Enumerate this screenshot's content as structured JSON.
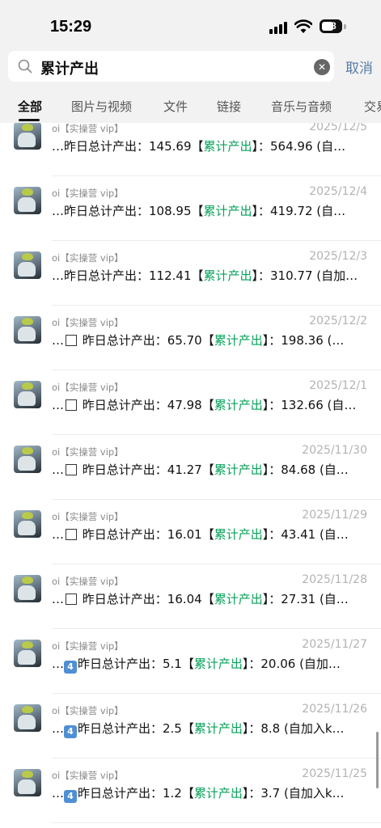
{
  "status": {
    "time": "15:29",
    "battery": "38"
  },
  "search": {
    "query": "累计产出",
    "cancel_label": "取消"
  },
  "tabs": [
    "全部",
    "图片与视频",
    "文件",
    "链接",
    "音乐与音频",
    "交易"
  ],
  "results": [
    {
      "sender": "oi【实操营 vip】",
      "date": "2025/12/5",
      "prefix": "…昨日总计产出：145.69【",
      "keyword": "累计产出",
      "suffix": "】：564.96 (自…",
      "glyph": ""
    },
    {
      "sender": "oi【实操营 vip】",
      "date": "2025/12/4",
      "prefix": "…昨日总计产出：108.95【",
      "keyword": "累计产出",
      "suffix": "】：419.72 (自…",
      "glyph": ""
    },
    {
      "sender": "oi【实操营 vip】",
      "date": "2025/12/3",
      "prefix": "…昨日总计产出：112.41【",
      "keyword": "累计产出",
      "suffix": "】：310.77 (自加…",
      "glyph": ""
    },
    {
      "sender": "oi【实操营 vip】",
      "date": "2025/12/2",
      "prefix": "昨日总计产出：65.70【",
      "keyword": "累计产出",
      "suffix": "】：198.36 (…",
      "glyph": "box"
    },
    {
      "sender": "oi【实操营 vip】",
      "date": "2025/12/1",
      "prefix": "昨日总计产出：47.98【",
      "keyword": "累计产出",
      "suffix": "】：132.66 (自…",
      "glyph": "box"
    },
    {
      "sender": "oi【实操营 vip】",
      "date": "2025/11/30",
      "prefix": "昨日总计产出：41.27【",
      "keyword": "累计产出",
      "suffix": "】：84.68 (自…",
      "glyph": "box"
    },
    {
      "sender": "oi【实操营 vip】",
      "date": "2025/11/29",
      "prefix": "昨日总计产出：16.01【",
      "keyword": "累计产出",
      "suffix": "】：43.41 (自…",
      "glyph": "box"
    },
    {
      "sender": "oi【实操营 vip】",
      "date": "2025/11/28",
      "prefix": "昨日总计产出：16.04【",
      "keyword": "累计产出",
      "suffix": "】：27.31 (自…",
      "glyph": "box"
    },
    {
      "sender": "oi【实操营 vip】",
      "date": "2025/11/27",
      "prefix": "昨日总计产出：5.1【",
      "keyword": "累计产出",
      "suffix": "】：20.06 (自加…",
      "glyph": "4"
    },
    {
      "sender": "oi【实操营 vip】",
      "date": "2025/11/26",
      "prefix": "昨日总计产出：2.5【",
      "keyword": "累计产出",
      "suffix": "】：8.8 (自加入k…",
      "glyph": "4"
    },
    {
      "sender": "oi【实操营 vip】",
      "date": "2025/11/25",
      "prefix": "昨日总计产出：1.2【",
      "keyword": "累计产出",
      "suffix": "】：3.7 (自加入k…",
      "glyph": "4"
    }
  ]
}
